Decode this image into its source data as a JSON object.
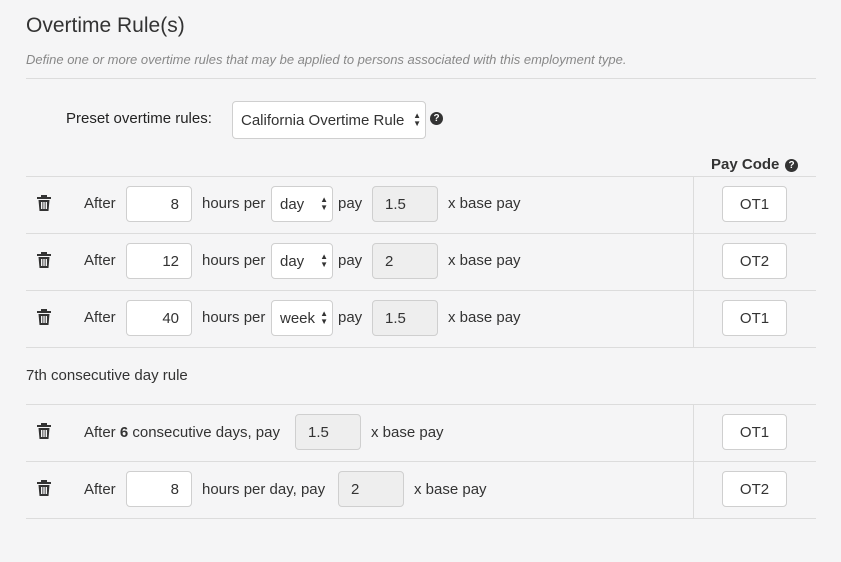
{
  "title": "Overtime Rule(s)",
  "description": "Define one or more overtime rules that may be applied to persons associated with this employment type.",
  "preset": {
    "label": "Preset overtime rules:",
    "value": "California Overtime Rule"
  },
  "pay_code_header": "Pay Code",
  "help_glyph": "?",
  "rules": [
    {
      "after": "After",
      "hours": "8",
      "hours_per": "hours per",
      "period": "day",
      "pay": "pay",
      "multiplier": "1.5",
      "x_base": "x base pay",
      "pay_code": "OT1"
    },
    {
      "after": "After",
      "hours": "12",
      "hours_per": "hours per",
      "period": "day",
      "pay": "pay",
      "multiplier": "2",
      "x_base": "x base pay",
      "pay_code": "OT2"
    },
    {
      "after": "After",
      "hours": "40",
      "hours_per": "hours per",
      "period": "week",
      "pay": "pay",
      "multiplier": "1.5",
      "x_base": "x base pay",
      "pay_code": "OT1"
    }
  ],
  "seventh_day": {
    "label": "7th consecutive day rule",
    "rule1": {
      "after": "After",
      "days": "6",
      "suffix": "consecutive days, pay",
      "multiplier": "1.5",
      "x_base": "x base pay",
      "pay_code": "OT1"
    },
    "rule2": {
      "after": "After",
      "hours": "8",
      "suffix": "hours per day, pay",
      "multiplier": "2",
      "x_base": "x base pay",
      "pay_code": "OT2"
    }
  },
  "icons": {
    "delete": "trash-icon",
    "help": "question-circle-icon",
    "select": "up-down-arrows-icon"
  }
}
